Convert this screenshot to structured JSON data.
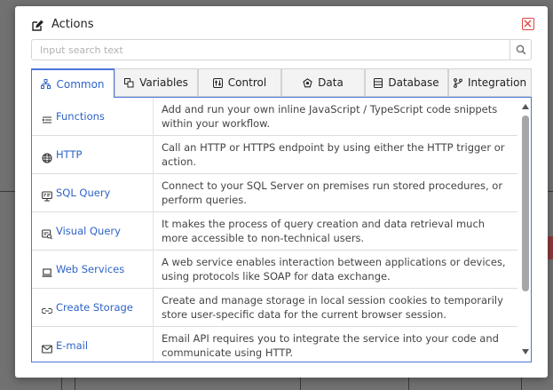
{
  "dialog": {
    "title": "Actions",
    "title_icon": "edit-icon",
    "close_icon": "close-icon"
  },
  "search": {
    "placeholder": "Input search text",
    "value": "",
    "icon": "search-icon"
  },
  "tabs": [
    {
      "label": "Common",
      "icon": "hierarchy-icon",
      "active": true
    },
    {
      "label": "Variables",
      "icon": "variables-icon",
      "active": false
    },
    {
      "label": "Control",
      "icon": "control-icon",
      "active": false
    },
    {
      "label": "Data",
      "icon": "data-icon",
      "active": false
    },
    {
      "label": "Database",
      "icon": "database-icon",
      "active": false
    },
    {
      "label": "Integration",
      "icon": "branch-icon",
      "active": false
    }
  ],
  "actions": [
    {
      "name": "Functions",
      "icon": "functions-icon",
      "description": "Add and run your own inline JavaScript / TypeScript code snippets within your workflow."
    },
    {
      "name": "HTTP",
      "icon": "globe-icon",
      "description": "Call an HTTP or HTTPS endpoint by using either the HTTP trigger or action."
    },
    {
      "name": "SQL Query",
      "icon": "sql-query-icon",
      "description": "Connect to your SQL Server on premises run stored procedures, or perform queries."
    },
    {
      "name": "Visual Query",
      "icon": "visual-query-icon",
      "description": "It makes the process of query creation and data retrieval much more accessible to non-technical users."
    },
    {
      "name": "Web Services",
      "icon": "laptop-icon",
      "description": "A web service enables interaction between applications or devices, using protocols like SOAP for data exchange."
    },
    {
      "name": "Create Storage",
      "icon": "link-icon",
      "description": "Create and manage storage in local session cookies to temporarily store user-specific data for the current browser session."
    },
    {
      "name": "E-mail",
      "icon": "mail-icon",
      "description": "Email API requires you to integrate the service into your code and communicate using HTTP."
    }
  ],
  "colors": {
    "accent": "#2e63c8",
    "active_border": "#4a76d8",
    "close": "#e0473f",
    "overlay": "#717171"
  }
}
